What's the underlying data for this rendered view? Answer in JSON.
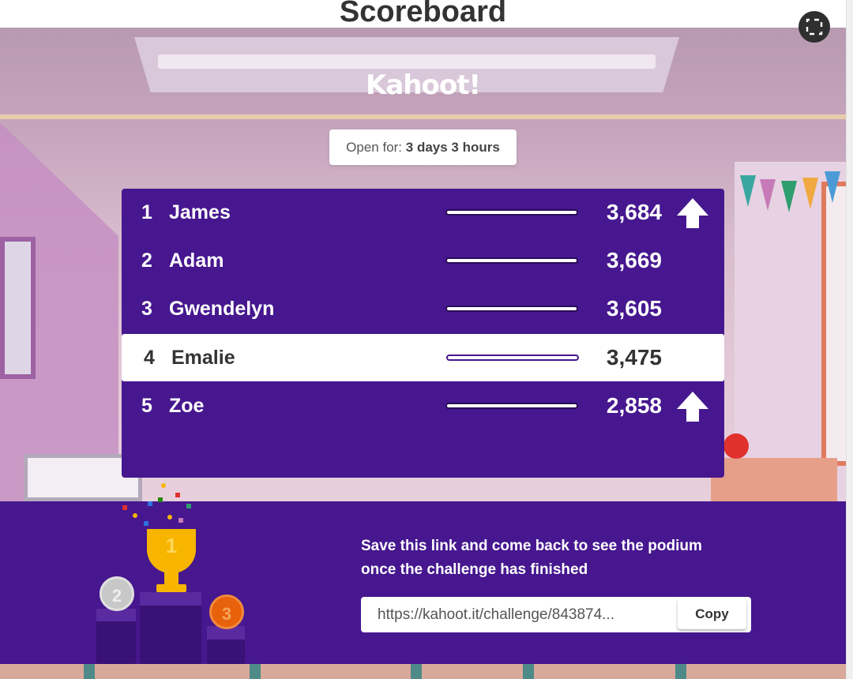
{
  "page": {
    "title": "Scoreboard"
  },
  "logo": {
    "text": "Kahoot!"
  },
  "open_for": {
    "label": "Open for:",
    "value": "3 days 3 hours"
  },
  "players": [
    {
      "rank": "1",
      "name": "James",
      "progress": 1.0,
      "score": "3,684",
      "arrow": "up-arrow-icon"
    },
    {
      "rank": "2",
      "name": "Adam",
      "progress": 1.0,
      "score": "3,669",
      "arrow": null
    },
    {
      "rank": "3",
      "name": "Gwendelyn",
      "progress": 1.0,
      "score": "3,605",
      "arrow": null
    },
    {
      "rank": "4",
      "name": "Emalie",
      "progress": 1.0,
      "score": "3,475",
      "arrow": null,
      "current_player": true
    },
    {
      "rank": "5",
      "name": "Zoe",
      "progress": 1.0,
      "score": "2,858",
      "arrow": "up-arrow-icon"
    }
  ],
  "podium": {
    "first": "1",
    "second": "2",
    "third": "3"
  },
  "share": {
    "message": "Save this link and come back to see the podium once the challenge has finished",
    "link": "https://kahoot.it/challenge/843874...",
    "copy_label": "Copy"
  },
  "colors": {
    "brand_purple": "#46178f",
    "gold": "#f7b500",
    "silver": "#c8c8c8",
    "bronze": "#e8610b"
  },
  "icons": {
    "fullscreen": "fullscreen-icon"
  }
}
